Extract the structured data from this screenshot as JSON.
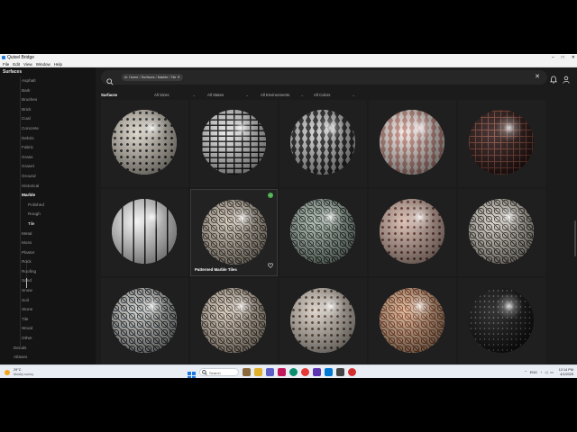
{
  "window": {
    "title": "Quixel Bridge",
    "menu": [
      "File",
      "Edit",
      "View",
      "Window",
      "Help"
    ]
  },
  "sidebar": {
    "header": "Surfaces",
    "items": [
      {
        "label": "Asphalt"
      },
      {
        "label": "Bark"
      },
      {
        "label": "Brushes"
      },
      {
        "label": "Brick"
      },
      {
        "label": "Coal"
      },
      {
        "label": "Concrete"
      },
      {
        "label": "Debris"
      },
      {
        "label": "Fabric"
      },
      {
        "label": "Grass"
      },
      {
        "label": "Gravel"
      },
      {
        "label": "Ground"
      },
      {
        "label": "Historical"
      },
      {
        "label": "Marble"
      },
      {
        "label": "Polished"
      },
      {
        "label": "Rough"
      },
      {
        "label": "Tile"
      },
      {
        "label": "Metal"
      },
      {
        "label": "Moss"
      },
      {
        "label": "Plaster"
      },
      {
        "label": "Rock"
      },
      {
        "label": "Roofing"
      },
      {
        "label": "Sand"
      },
      {
        "label": "Snow"
      },
      {
        "label": "Soil"
      },
      {
        "label": "Stone"
      },
      {
        "label": "Tile"
      },
      {
        "label": "Wood"
      },
      {
        "label": "Other"
      },
      {
        "label": "Decals"
      },
      {
        "label": "Atlases"
      }
    ]
  },
  "search": {
    "breadcrumb_chip": "In: Home / Surfaces / Marble / Tile"
  },
  "filters": {
    "category": "Surfaces",
    "sizes": "All Sizes",
    "states": "All States",
    "environments": "All Environments",
    "colors": "All Colors"
  },
  "grid": {
    "hover_label": "Patterned Marble Tiles",
    "tiles": [
      {
        "c1": "#d9d3c6",
        "c2": "#2a2a2a",
        "pattern": "dots"
      },
      {
        "c1": "#e8e8e8",
        "c2": "#111111",
        "pattern": "greek"
      },
      {
        "c1": "#2b2b2b",
        "c2": "#cfcfcf",
        "pattern": "tri"
      },
      {
        "c1": "#c98f86",
        "c2": "#f1e8e3",
        "pattern": "tri"
      },
      {
        "c1": "#2c1716",
        "c2": "#8a4a3a",
        "pattern": "grid"
      },
      {
        "c1": "#f2f2f2",
        "c2": "#111111",
        "pattern": "stripes"
      },
      {
        "c1": "#d2c6b5",
        "c2": "#403a33",
        "pattern": "star"
      },
      {
        "c1": "#a9b8ad",
        "c2": "#26332c",
        "pattern": "star"
      },
      {
        "c1": "#d6b8ab",
        "c2": "#6d3b34",
        "pattern": "dots"
      },
      {
        "c1": "#d8d2c8",
        "c2": "#3b3630",
        "pattern": "star"
      },
      {
        "c1": "#cfcac2",
        "c2": "#1e2f3a",
        "pattern": "star"
      },
      {
        "c1": "#d8cec0",
        "c2": "#4b3a2a",
        "pattern": "star"
      },
      {
        "c1": "#d9cfc4",
        "c2": "#5a4638",
        "pattern": "dots"
      },
      {
        "c1": "#d7b493",
        "c2": "#8c3c1e",
        "pattern": "star"
      },
      {
        "c1": "#121212",
        "c2": "#8a8a8a",
        "pattern": "specks"
      }
    ]
  },
  "taskbar": {
    "weather_temp": "29°C",
    "weather_cond": "Mostly sunny",
    "search_placeholder": "Search",
    "lang": "ENG",
    "time": "12:14 PM",
    "date": "4/1/2025"
  },
  "colors": {
    "accent_green": "#4caf50",
    "bg": "#1b1b1b",
    "sidebar": "#141414"
  }
}
